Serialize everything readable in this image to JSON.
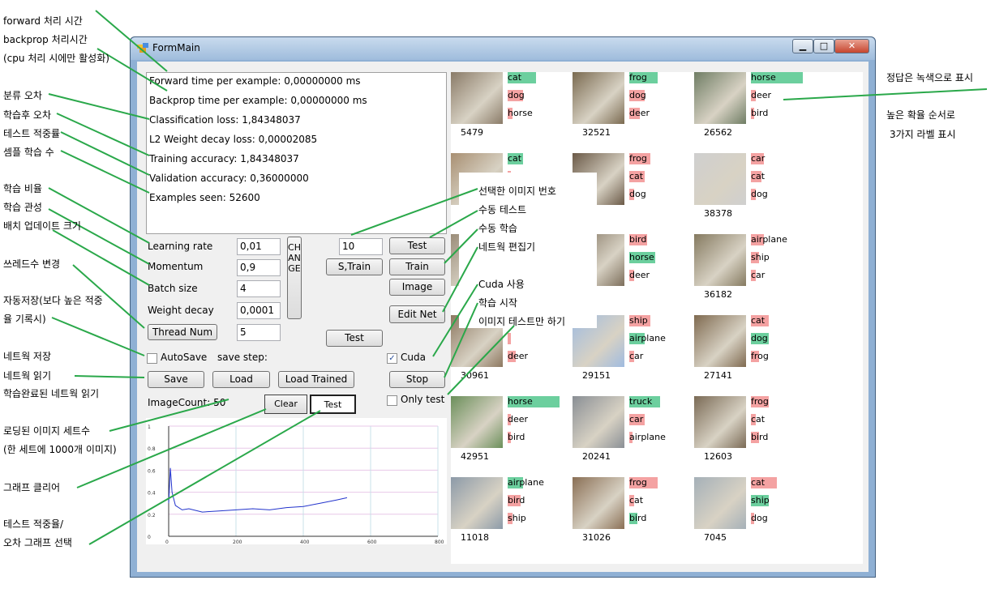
{
  "window": {
    "title": "FormMain"
  },
  "info": {
    "forward_time": "Forward time per example: 0,00000000 ms",
    "backprop_time": "Backprop time per example: 0,00000000 ms",
    "classification_loss": "Classification loss: 1,84348037",
    "l2_loss": "L2 Weight decay loss: 0,00002085",
    "training_accuracy": "Training accuracy: 1,84348037",
    "validation_accuracy": "Validation accuracy: 0,36000000",
    "examples_seen": "Examples seen: 52600"
  },
  "params": {
    "learning_rate_label": "Learning rate",
    "learning_rate_value": "0,01",
    "momentum_label": "Momentum",
    "momentum_value": "0,9",
    "batch_size_label": "Batch size",
    "batch_size_value": "4",
    "weight_decay_label": "Weight decay",
    "weight_decay_value": "0,0001",
    "thread_num_button": "Thread Num",
    "thread_num_value": "5",
    "change_button": "CHANGE",
    "image_index_value": "10",
    "strain_button": "S,Train",
    "test_mid_button": "Test"
  },
  "buttons": {
    "test": "Test",
    "train": "Train",
    "image": "Image",
    "edit_net": "Edit Net",
    "save": "Save",
    "load": "Load",
    "load_trained": "Load Trained",
    "stop": "Stop",
    "clear": "Clear",
    "graph_test": "Test"
  },
  "options": {
    "autosave_label": "AutoSave",
    "autosave_checked": false,
    "save_step_label": "save step:",
    "cuda_label": "Cuda",
    "cuda_checked": true,
    "only_test_label": "Only test",
    "only_test_checked": false
  },
  "image_count": "ImageCount: 50",
  "graph": {
    "y_ticks": [
      "1",
      "0.8",
      "0.6",
      "0.4",
      "0.2",
      "0"
    ],
    "x_ticks": [
      "0",
      "200",
      "400",
      "600",
      "800"
    ]
  },
  "chart_data": {
    "type": "line",
    "x": [
      0,
      5,
      10,
      20,
      40,
      60,
      100,
      150,
      200,
      250,
      300,
      350,
      400,
      450,
      500,
      530
    ],
    "y": [
      0.3,
      0.62,
      0.4,
      0.28,
      0.24,
      0.25,
      0.22,
      0.23,
      0.24,
      0.25,
      0.24,
      0.26,
      0.27,
      0.3,
      0.33,
      0.35
    ],
    "xlim": [
      0,
      800
    ],
    "ylim": [
      0,
      1
    ],
    "grid": true
  },
  "colors": {
    "correct": "#6ccf9e",
    "wrong": "#f4a2a2"
  },
  "gallery": [
    {
      "id": "5479",
      "labels": [
        [
          "cat",
          0.55,
          "c"
        ],
        [
          "dog",
          0.3,
          "w"
        ],
        [
          "horse",
          0.1,
          "w"
        ]
      ]
    },
    {
      "id": "32521",
      "labels": [
        [
          "frog",
          0.55,
          "c"
        ],
        [
          "dog",
          0.3,
          "w"
        ],
        [
          "deer",
          0.2,
          "w"
        ]
      ]
    },
    {
      "id": "26562",
      "labels": [
        [
          "horse",
          1.0,
          "c"
        ],
        [
          "deer",
          0.1,
          "w"
        ],
        [
          "bird",
          0.05,
          "w"
        ]
      ]
    },
    {
      "id": "",
      "labels": [
        [
          "cat",
          0.3,
          "c"
        ],
        [
          "",
          0.05,
          "w"
        ],
        [
          "",
          0.05,
          "w"
        ]
      ]
    },
    {
      "id": "",
      "labels": [
        [
          "frog",
          0.4,
          "w"
        ],
        [
          "cat",
          0.3,
          "w"
        ],
        [
          "dog",
          0.1,
          "w"
        ]
      ]
    },
    {
      "id": "38378",
      "labels": [
        [
          "car",
          0.25,
          "w"
        ],
        [
          "cat",
          0.2,
          "w"
        ],
        [
          "dog",
          0.1,
          "w"
        ]
      ]
    },
    {
      "id": "",
      "labels": [
        [
          "",
          0.05,
          "w"
        ],
        [
          "",
          0.05,
          "w"
        ],
        [
          "",
          0.05,
          "w"
        ]
      ]
    },
    {
      "id": "",
      "labels": [
        [
          "bird",
          0.35,
          "w"
        ],
        [
          "horse",
          0.5,
          "c"
        ],
        [
          "deer",
          0.1,
          "w"
        ]
      ]
    },
    {
      "id": "36182",
      "labels": [
        [
          "airplane",
          0.25,
          "w"
        ],
        [
          "ship",
          0.15,
          "w"
        ],
        [
          "car",
          0.1,
          "w"
        ]
      ]
    },
    {
      "id": "30961",
      "labels": [
        [
          "",
          0.05,
          "w"
        ],
        [
          "",
          0.05,
          "w"
        ],
        [
          "deer",
          0.15,
          "w"
        ]
      ]
    },
    {
      "id": "29151",
      "labels": [
        [
          "ship",
          0.4,
          "w"
        ],
        [
          "airplane",
          0.3,
          "c"
        ],
        [
          "car",
          0.1,
          "w"
        ]
      ]
    },
    {
      "id": "27141",
      "labels": [
        [
          "cat",
          0.35,
          "w"
        ],
        [
          "dog",
          0.35,
          "c"
        ],
        [
          "frog",
          0.15,
          "w"
        ]
      ]
    },
    {
      "id": "42951",
      "labels": [
        [
          "horse",
          1.0,
          "c"
        ],
        [
          "deer",
          0.05,
          "w"
        ],
        [
          "bird",
          0.05,
          "w"
        ]
      ]
    },
    {
      "id": "20241",
      "labels": [
        [
          "truck",
          0.6,
          "c"
        ],
        [
          "car",
          0.3,
          "w"
        ],
        [
          "airplane",
          0.05,
          "w"
        ]
      ]
    },
    {
      "id": "12603",
      "labels": [
        [
          "frog",
          0.35,
          "w"
        ],
        [
          "cat",
          0.1,
          "w"
        ],
        [
          "bird",
          0.15,
          "w"
        ]
      ]
    },
    {
      "id": "11018",
      "labels": [
        [
          "airplane",
          0.3,
          "c"
        ],
        [
          "bird",
          0.25,
          "w"
        ],
        [
          "ship",
          0.1,
          "w"
        ]
      ]
    },
    {
      "id": "31026",
      "labels": [
        [
          "frog",
          0.55,
          "w"
        ],
        [
          "cat",
          0.1,
          "w"
        ],
        [
          "bird",
          0.15,
          "c"
        ]
      ]
    },
    {
      "id": "7045",
      "labels": [
        [
          "cat",
          0.5,
          "w"
        ],
        [
          "ship",
          0.35,
          "c"
        ],
        [
          "dog",
          0.05,
          "w"
        ]
      ]
    }
  ],
  "annotations": {
    "forward": "forward 처리 시간",
    "backprop": "backprop 처리시간",
    "cpu_only": "(cpu 처리 시에만 활성화)",
    "class_error": "분류 오차",
    "train_error": "학습후 오차",
    "test_accuracy": "테스트 적중률",
    "samples_learned": "셈플 학습 수",
    "learning_rate": "학습 비율",
    "momentum": "학습 관성",
    "batch_size": "배치 업데이트 크기",
    "thread_change": "쓰레드수 변경",
    "autosave1": "자동저장(보다 높은 적중",
    "autosave2": "율 기록시)",
    "net_save": "네트웍 저장",
    "net_load": "네트웍 읽기",
    "net_load_trained": "학습완료된 네트웍 읽기",
    "loaded_sets1": "로딩된 이미지 세트수",
    "loaded_sets2": "(한 세트에 1000개 이미지)",
    "graph_clear": "그래프 클리어",
    "graph_select1": "테스트 적중율/",
    "graph_select2": "오차 그래프 선택",
    "correct_green": "정답은 녹색으로 표시",
    "prob_order1": "높은 확율 순서로",
    "prob_order2": "3가지 라벨 표시",
    "selected_image": "선택한 이미지 번호",
    "manual_test": "수동 테스트",
    "manual_train": "수동 학습",
    "net_edit": "네트웍 편집기",
    "cuda_use": "Cuda 사용",
    "train_start": "학습 시작",
    "image_test_only": "이미지 테스트만 하기"
  }
}
